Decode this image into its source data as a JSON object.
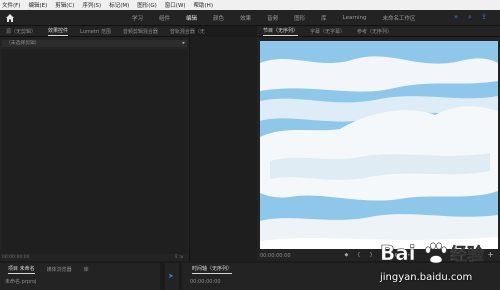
{
  "menubar": {
    "items": [
      "文件(F)",
      "编辑(E)",
      "剪辑(C)",
      "序列(S)",
      "标记(M)",
      "图形(G)",
      "窗口(W)",
      "帮助(H)"
    ]
  },
  "workspaces": {
    "tabs": [
      "学习",
      "组件",
      "编辑",
      "颜色",
      "效果",
      "音频",
      "图形",
      "库",
      "Learning",
      "未命名工作区"
    ],
    "active_index": 2
  },
  "left_panel": {
    "tabs": [
      "源（无剪辑）",
      "效果控件",
      "Lumetri 范围",
      "音频剪辑混合器",
      "音轨混合器（无"
    ],
    "active_index": 1,
    "sub_label": "（未选择剪辑）",
    "timecode": "00:00:00:00"
  },
  "program_monitor": {
    "tabs": [
      "节目（无序列）",
      "字幕（无字幕）",
      "参考（无序列）"
    ],
    "active_index": 0,
    "timecode": "00:00:00:00"
  },
  "project_panel": {
    "tabs": [
      "项目 未命名",
      "媒体浏览器",
      "库"
    ],
    "item_name": "未命名.prproj"
  },
  "timeline": {
    "tabs": [
      "时间轴（无序列）"
    ],
    "timecode": "00:00:00:00"
  },
  "watermark": {
    "brand": "Bai 经验",
    "url": "jingyan.baidu.com"
  },
  "colors": {
    "accent": "#3d7bd8",
    "sky": "#8fc7ea",
    "cloud": "#f2f6fa",
    "cursor": "#e8367a"
  }
}
